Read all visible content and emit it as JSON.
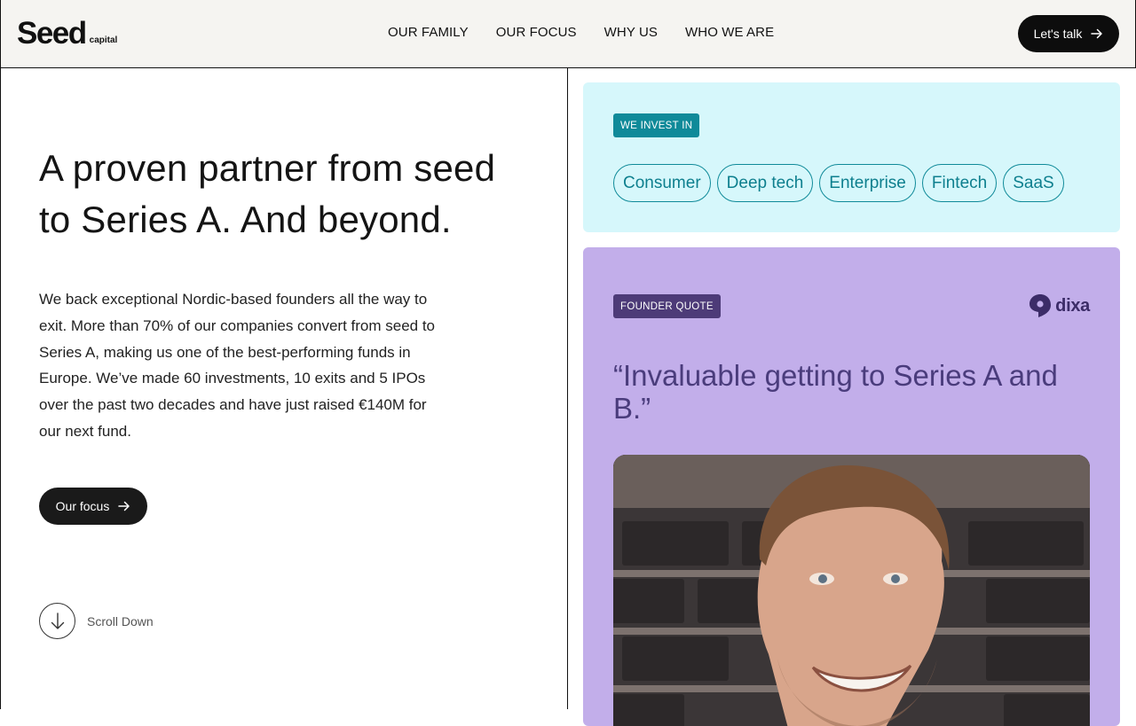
{
  "header": {
    "logo_main": "Seed",
    "logo_sub": "capital",
    "nav": [
      "OUR FAMILY",
      "OUR FOCUS",
      "WHY US",
      "WHO WE ARE"
    ],
    "cta_label": "Let's talk",
    "cta_icon": "arrow-right-icon"
  },
  "hero": {
    "title": "A proven partner from seed to Series A. And beyond.",
    "body": "We back exceptional Nordic-based founders all the way to exit. More than 70% of our companies convert from seed to Series A, making us one of the best-performing funds in Europe. We’ve made 60 investments, 10 exits and 5 IPOs over the past two decades and have just raised €140M for our next fund.",
    "button_label": "Our focus",
    "scroll_label": "Scroll Down"
  },
  "invest": {
    "tag": "WE INVEST IN",
    "chips": [
      "Consumer",
      "Deep tech",
      "Enterprise",
      "Fintech",
      "SaaS"
    ]
  },
  "quote": {
    "tag": "FOUNDER QUOTE",
    "company_logo": "dixa",
    "text": "“Invaluable getting to Series A and B.”",
    "photo": "founder-portrait"
  },
  "colors": {
    "header_bg": "#f5f4f1",
    "invest_bg": "#d6f7fb",
    "invest_accent": "#0f8a99",
    "quote_bg": "#c2aeea",
    "quote_accent": "#4d3b78",
    "button_bg": "#0d0d0d"
  }
}
